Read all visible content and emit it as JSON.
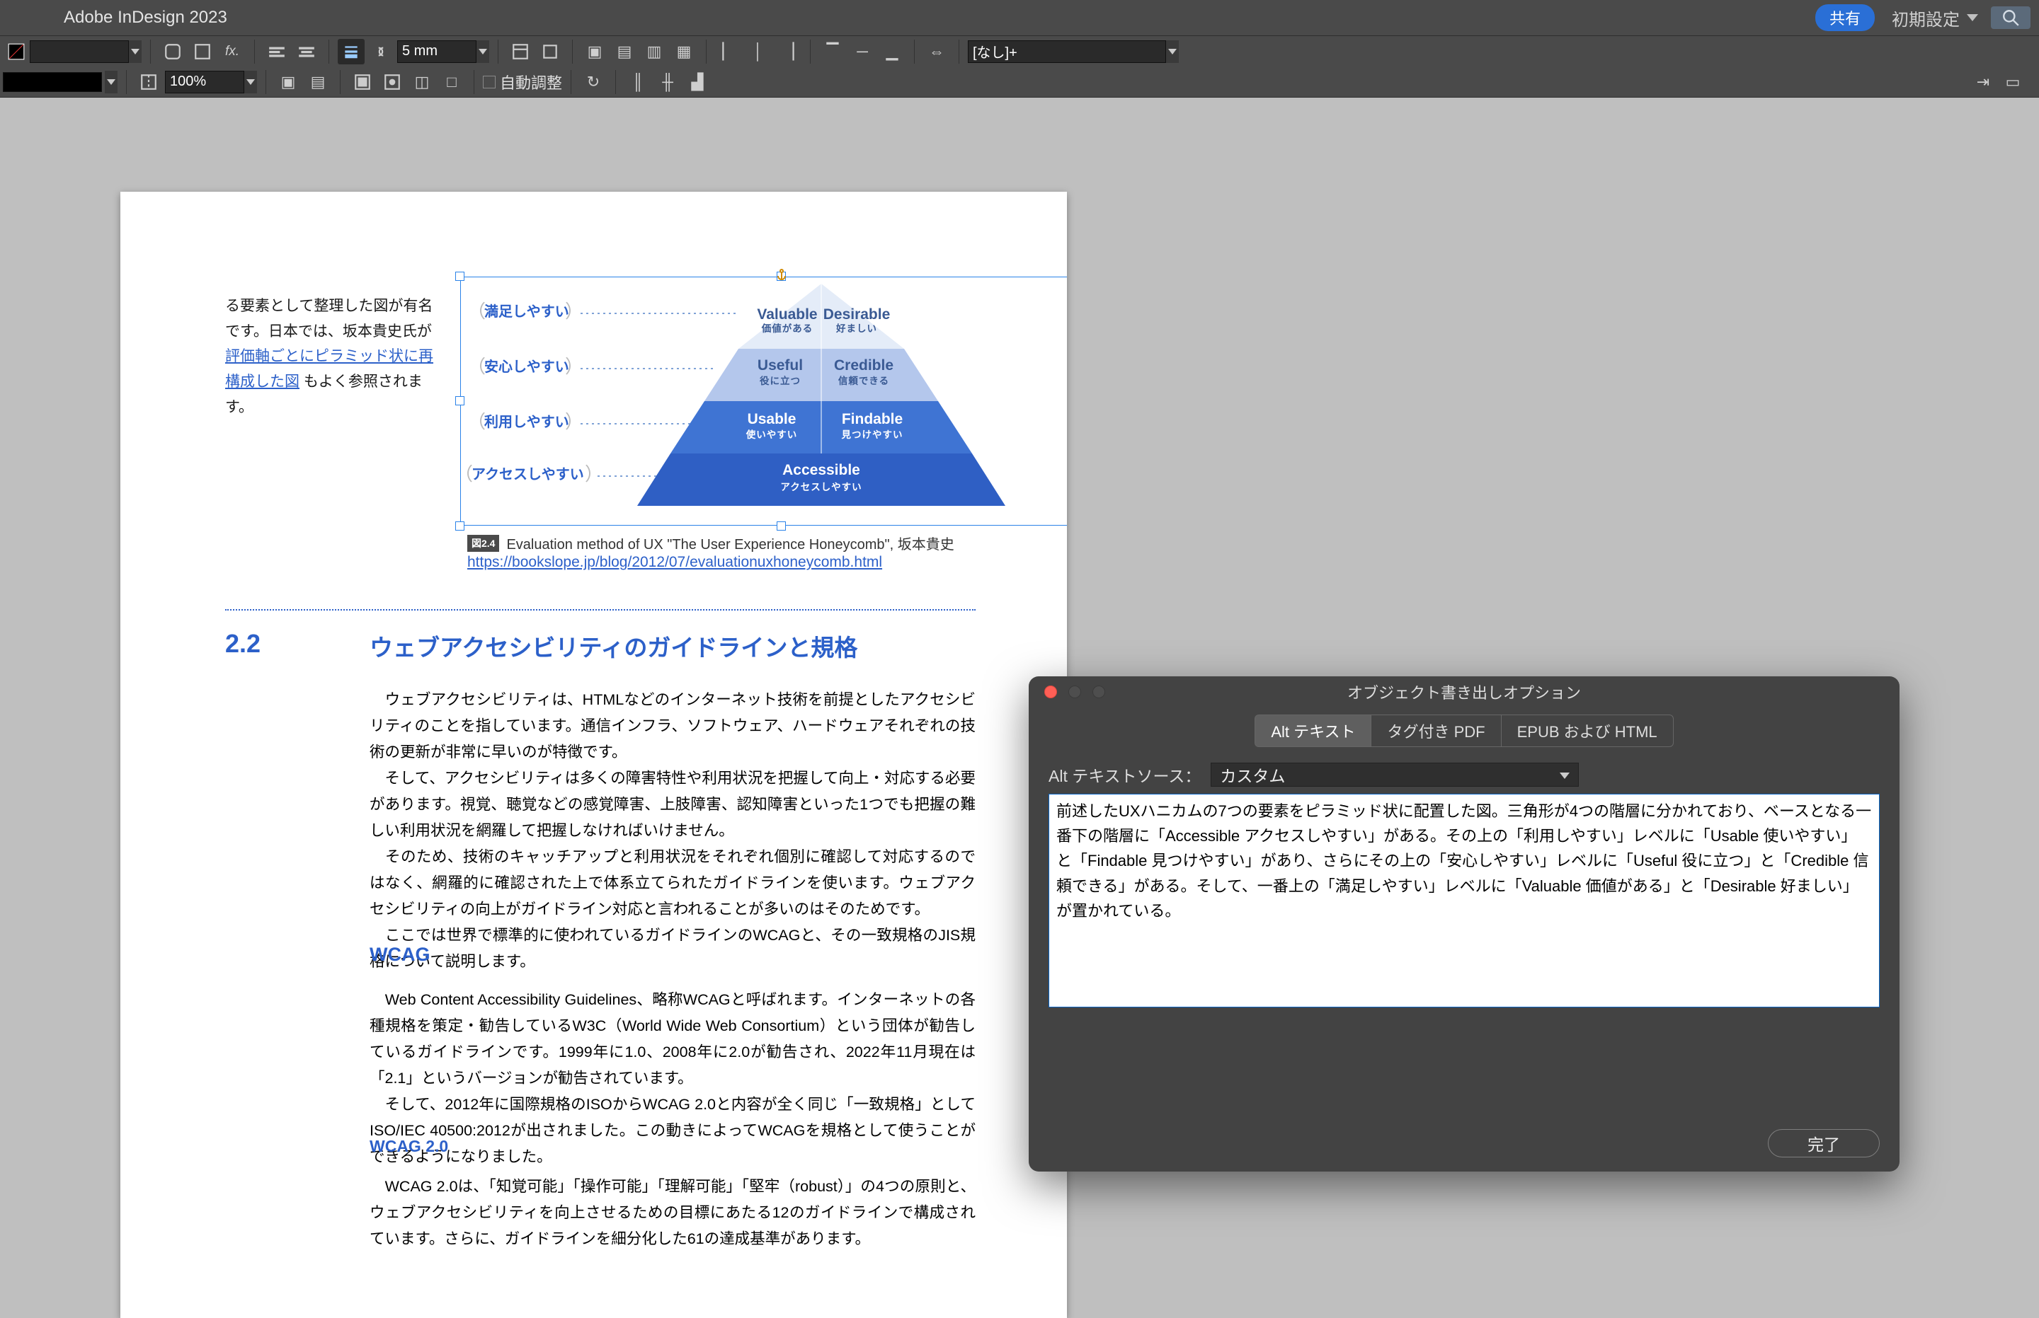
{
  "menubar": {
    "app_title": "Adobe InDesign 2023",
    "share_label": "共有",
    "workspace_label": "初期設定"
  },
  "toolbar": {
    "color_input": "",
    "fill_w": "",
    "gap_value": "5 mm",
    "style_select": "[なし]+",
    "opacity_value": "100%",
    "auto_fit_label": "自動調整"
  },
  "document": {
    "intro_text_1": "る要素として整理した図が有名です。日本では、坂本貴史氏が",
    "intro_link": "評価軸ごとにピラミッド状に再構成した図",
    "intro_text_2": "もよく参照されます。",
    "figure": {
      "badge": "図2.4",
      "caption": "Evaluation method of UX \"The User Experience Honeycomb\", 坂本貴史",
      "url": "https://bookslope.jp/blog/2012/07/evaluationuxhoneycomb.html"
    },
    "section_number": "2.2",
    "section_title": "ウェブアクセシビリティのガイドラインと規格",
    "para1": "　ウェブアクセシビリティは、HTMLなどのインターネット技術を前提としたアクセシビリティのことを指しています。通信インフラ、ソフトウェア、ハードウェアそれぞれの技術の更新が非常に早いのが特徴です。\n　そして、アクセシビリティは多くの障害特性や利用状況を把握して向上・対応する必要があります。視覚、聴覚などの感覚障害、上肢障害、認知障害といった1つでも把握の難しい利用状況を網羅して把握しなければいけません。\n　そのため、技術のキャッチアップと利用状況をそれぞれ個別に確認して対応するのではなく、網羅的に確認された上で体系立てられたガイドラインを使います。ウェブアクセシビリティの向上がガイドライン対応と言われることが多いのはそのためです。\n　ここでは世界で標準的に使われているガイドラインのWCAGと、その一致規格のJIS規格について説明します。",
    "h3_wcag": "WCAG",
    "para2": "　Web Content Accessibility Guidelines、略称WCAGと呼ばれます。インターネットの各種規格を策定・勧告しているW3C（World Wide Web Consortium）という団体が勧告しているガイドラインです。1999年に1.0、2008年に2.0が勧告され、2022年11月現在は「2.1」というバージョンが勧告されています。\n　そして、2012年に国際規格のISOからWCAG 2.0と内容が全く同じ「一致規格」としてISO/IEC 40500:2012が出されました。この動きによってWCAGを規格として使うことができるようになりました。",
    "h4_wcag20": "WCAG 2.0",
    "para3": "　WCAG 2.0は、「知覚可能」「操作可能」「理解可能」「堅牢（robust）」の4つの原則と、ウェブアクセシビリティを向上させるための目標にあたる12のガイドラインで構成されています。さらに、ガイドラインを細分化した61の達成基準があります。"
  },
  "pyramid": {
    "row1_label": "満足しやすい",
    "row2_label": "安心しやすい",
    "row3_label": "利用しやすい",
    "row4_label": "アクセスしやすい",
    "l1a_en": "Valuable",
    "l1a_jp": "価値がある",
    "l1b_en": "Desirable",
    "l1b_jp": "好ましい",
    "l2a_en": "Useful",
    "l2a_jp": "役に立つ",
    "l2b_en": "Credible",
    "l2b_jp": "信頼できる",
    "l3a_en": "Usable",
    "l3a_jp": "使いやすい",
    "l3b_en": "Findable",
    "l3b_jp": "見つけやすい",
    "l4_en": "Accessible",
    "l4_jp": "アクセスしやすい"
  },
  "dialog": {
    "title": "オブジェクト書き出しオプション",
    "tabs": {
      "alt": "Alt テキスト",
      "pdf": "タグ付き PDF",
      "epub": "EPUB および HTML"
    },
    "alt_source_label": "Alt テキストソース：",
    "alt_source_value": "カスタム",
    "alt_text": "前述したUXハニカムの7つの要素をピラミッド状に配置した図。三角形が4つの階層に分かれており、ベースとなる一番下の階層に「Accessible アクセスしやすい」がある。その上の「利用しやすい」レベルに「Usable 使いやすい」と「Findable 見つけやすい」があり、さらにその上の「安心しやすい」レベルに「Useful 役に立つ」と「Credible 信頼できる」がある。そして、一番上の「満足しやすい」レベルに「Valuable 価値がある」と「Desirable 好ましい」が置かれている。",
    "done_label": "完了"
  },
  "colors": {
    "brand_blue": "#2c60c9",
    "deep_blue": "#2f5fc4"
  },
  "chart_data": {
    "type": "pyramid",
    "title": "Evaluation method of UX \"The User Experience Honeycomb\"",
    "levels": [
      {
        "row_label_jp": "満足しやすい",
        "items": [
          {
            "en": "Valuable",
            "jp": "価値がある"
          },
          {
            "en": "Desirable",
            "jp": "好ましい"
          }
        ]
      },
      {
        "row_label_jp": "安心しやすい",
        "items": [
          {
            "en": "Useful",
            "jp": "役に立つ"
          },
          {
            "en": "Credible",
            "jp": "信頼できる"
          }
        ]
      },
      {
        "row_label_jp": "利用しやすい",
        "items": [
          {
            "en": "Usable",
            "jp": "使いやすい"
          },
          {
            "en": "Findable",
            "jp": "見つけやすい"
          }
        ]
      },
      {
        "row_label_jp": "アクセスしやすい",
        "items": [
          {
            "en": "Accessible",
            "jp": "アクセスしやすい"
          }
        ]
      }
    ]
  }
}
